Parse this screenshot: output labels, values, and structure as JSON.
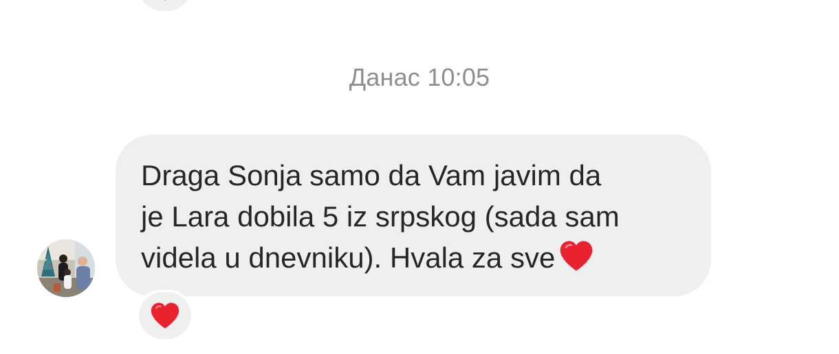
{
  "chat": {
    "timestamp": "Данас 10:05",
    "message": {
      "line1": "Draga Sonja samo da Vam javim da",
      "line2": "je Lara dobila 5 iz srpskog (sada sam",
      "line3": "videla u dnevniku). Hvala za sve",
      "emoji": "red-heart-emoji"
    },
    "reactions": {
      "previous_message": "red-heart-emoji",
      "this_message": "red-heart-emoji"
    }
  },
  "colors": {
    "bubble": "#efefef",
    "text": "#262626",
    "timestamp": "#8e8e8e",
    "heart": "#e8232f"
  }
}
